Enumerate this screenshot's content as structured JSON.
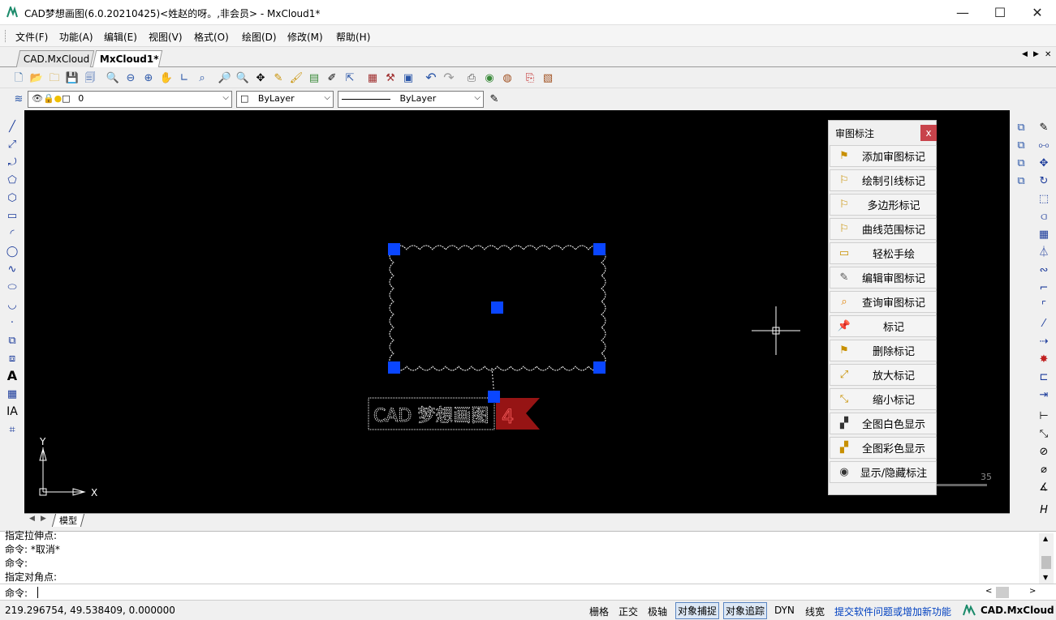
{
  "window": {
    "title": "CAD梦想画图(6.0.20210425)<姓赵的呀。,非会员> - MxCloud1*",
    "minimize_glyph": "—",
    "maximize_glyph": "☐",
    "close_glyph": "✕"
  },
  "menu": [
    "文件(F)",
    "功能(A)",
    "编辑(E)",
    "视图(V)",
    "格式(O)",
    "绘图(D)",
    "修改(M)",
    "帮助(H)"
  ],
  "doc_tabs": [
    {
      "label": "CAD.MxCloud",
      "active": false
    },
    {
      "label": "MxCloud1*",
      "active": true
    }
  ],
  "tab_nav": {
    "prev": "◀",
    "next": "▶",
    "close": "✕"
  },
  "layer_toolbar": {
    "layer_value": "0",
    "color_value": "ByLayer",
    "linetype_value": "ByLayer"
  },
  "canvas": {
    "markup_text": "CAD 梦想画图",
    "flag_number": "4",
    "scale_label": "35",
    "axis_x": "X",
    "axis_y": "Y"
  },
  "markup_panel": {
    "title": "审图标注",
    "close_label": "x",
    "buttons": [
      {
        "label": "添加审图标记",
        "icon": "flag-icon"
      },
      {
        "label": "绘制引线标记",
        "icon": "leader-flag-icon"
      },
      {
        "label": "多边形标记",
        "icon": "polygon-flag-icon"
      },
      {
        "label": "曲线范围标记",
        "icon": "curve-flag-icon"
      },
      {
        "label": "轻松手绘",
        "icon": "freehand-icon"
      },
      {
        "label": "编辑审图标记",
        "icon": "edit-icon"
      },
      {
        "label": "查询审图标记",
        "icon": "query-icon"
      },
      {
        "label": "标记",
        "icon": "pin-icon"
      },
      {
        "label": "删除标记",
        "icon": "delete-flag-icon"
      },
      {
        "label": "放大标记",
        "icon": "enlarge-icon"
      },
      {
        "label": "缩小标记",
        "icon": "shrink-icon"
      },
      {
        "label": "全图白色显示",
        "icon": "white-display-icon"
      },
      {
        "label": "全图彩色显示",
        "icon": "color-display-icon"
      },
      {
        "label": "显示/隐藏标注",
        "icon": "eye-icon"
      }
    ]
  },
  "model_tab": "模型",
  "command": {
    "history": [
      "指定拉伸点:",
      "命令:    *取消*",
      "命令:",
      " 指定对角点:"
    ],
    "prompt": "命令:"
  },
  "status": {
    "coords": "219.296754,  49.538409,  0.000000",
    "toggles": [
      {
        "label": "栅格",
        "on": false
      },
      {
        "label": "正交",
        "on": false
      },
      {
        "label": "极轴",
        "on": false
      },
      {
        "label": "对象捕捉",
        "on": true
      },
      {
        "label": "对象追踪",
        "on": true
      },
      {
        "label": "DYN",
        "on": false
      },
      {
        "label": "线宽",
        "on": false
      }
    ],
    "feedback_link": "提交软件问题或增加新功能",
    "brand": "CAD.MxCloud"
  },
  "colors": {
    "grip_blue": "#0a46ff",
    "link_blue": "#0040c0",
    "panel_close_red": "#c8434b",
    "flag_red": "#b01818"
  }
}
